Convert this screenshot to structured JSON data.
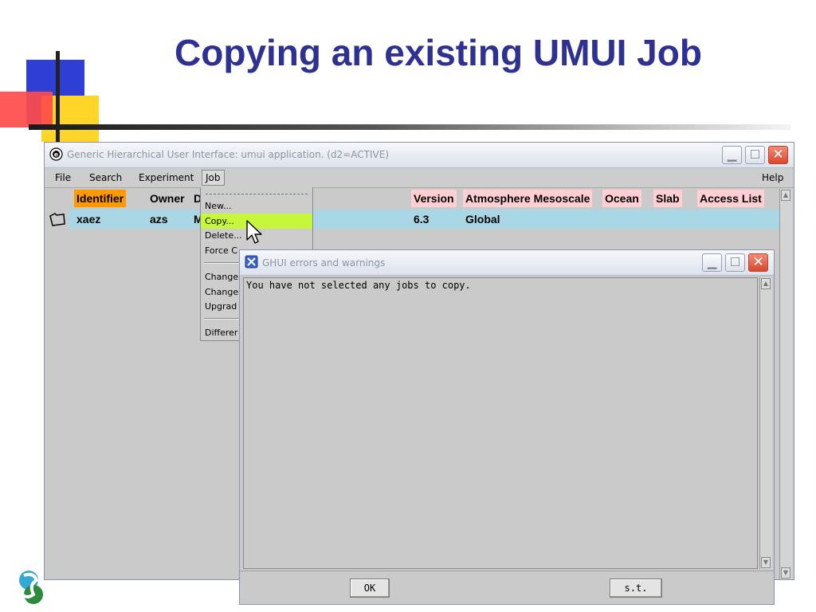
{
  "slide": {
    "title": "Copying an existing UMUI Job"
  },
  "main_window": {
    "title": "Generic Hierarchical User Interface: umui application. (d2=ACTIVE)",
    "menus": {
      "file": "File",
      "search": "Search",
      "experiment": "Experiment",
      "job": "Job",
      "help": "Help"
    },
    "columns": [
      "Identifier",
      "Owner",
      "D",
      "Version",
      "Atmosphere Mesoscale",
      "Ocean",
      "Slab",
      "Access List"
    ],
    "rows": [
      {
        "identifier": "xaez",
        "owner": "azs",
        "description": "M",
        "version": "6.3",
        "atmosphere": "Global"
      }
    ]
  },
  "job_menu": {
    "items": [
      "New...",
      "Copy...",
      "Delete...",
      "Force C",
      "Change",
      "Change",
      "Upgrad",
      "Differer"
    ],
    "active_item": "Copy..."
  },
  "dialog": {
    "title": "GHUI errors and warnings",
    "message": "You have not selected any jobs to copy.",
    "ok_label": "OK",
    "st_label": "s.t."
  },
  "colors": {
    "title": "#2e3192",
    "identifier_header": "#ff9900",
    "column_header": "#ffcfd4",
    "selected_row": "#aad7e5",
    "menu_highlight": "#c6f73a"
  }
}
